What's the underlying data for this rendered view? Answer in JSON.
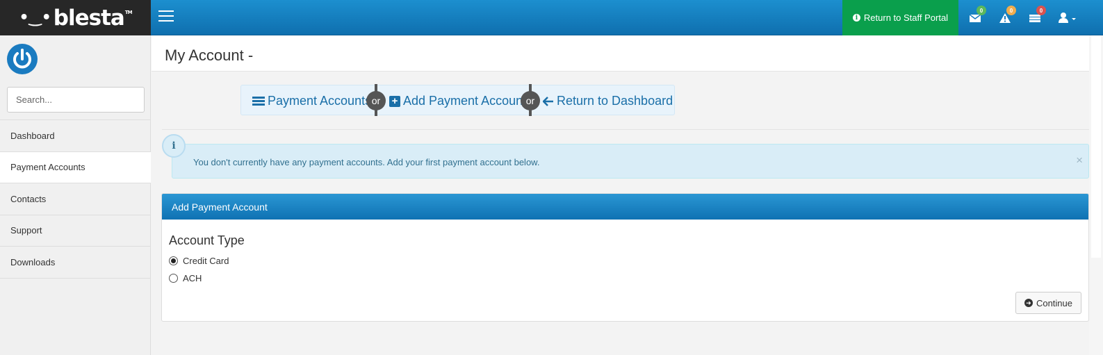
{
  "brand": {
    "name": "blesta",
    "dots": "•‿•",
    "tm": "TM"
  },
  "topbar": {
    "staff_portal_label": "Return to Staff Portal",
    "badges": {
      "messages": "0",
      "alerts": "0",
      "tickets": "0"
    },
    "colors": {
      "messages": "#5cb85c",
      "alerts": "#f0ad4e",
      "tickets": "#d9534f"
    }
  },
  "sidebar": {
    "search_placeholder": "Search...",
    "items": [
      {
        "label": "Dashboard"
      },
      {
        "label": "Payment Accounts"
      },
      {
        "label": "Contacts"
      },
      {
        "label": "Support"
      },
      {
        "label": "Downloads"
      }
    ]
  },
  "page": {
    "title": "My Account -"
  },
  "actions": {
    "payment_accounts": "Payment Accounts",
    "or": "or",
    "add_payment_account": "Add Payment Account",
    "return_dashboard": "Return to Dashboard"
  },
  "alert": {
    "message": "You don't currently have any payment accounts. Add your first payment account below.",
    "close": "×",
    "icon": "i"
  },
  "panel": {
    "title": "Add Payment Account",
    "account_type_label": "Account Type",
    "options": [
      {
        "label": "Credit Card",
        "checked": true
      },
      {
        "label": "ACH",
        "checked": false
      }
    ],
    "continue_label": "Continue"
  }
}
